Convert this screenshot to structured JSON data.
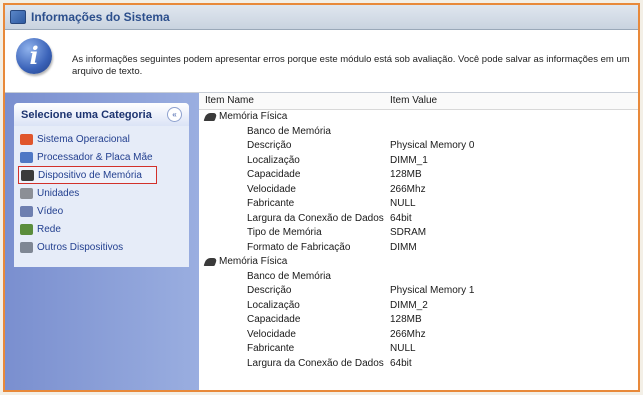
{
  "window": {
    "title": "Informações do Sistema"
  },
  "info": {
    "message": "As informações seguintes podem apresentar erros porque este módulo está sob avaliação. Você pode salvar as informações em um arquivo de texto."
  },
  "sidebar": {
    "header": "Selecione uma Categoria",
    "collapse_glyph": "«",
    "items": [
      {
        "label": "Sistema Operacional",
        "icon": "windows-flag-icon",
        "color": "#e0562c"
      },
      {
        "label": "Processador & Placa Mãe",
        "icon": "processor-icon",
        "color": "#4f78c5"
      },
      {
        "label": "Dispositivo de Memória",
        "icon": "memory-icon",
        "color": "#3b3b3b",
        "selected": true
      },
      {
        "label": "Unidades",
        "icon": "drives-icon",
        "color": "#8c8f96"
      },
      {
        "label": "Vídeo",
        "icon": "video-icon",
        "color": "#6e7fb0"
      },
      {
        "label": "Rede",
        "icon": "network-icon",
        "color": "#5b8d3c"
      },
      {
        "label": "Outros Dispositivos",
        "icon": "devices-icon",
        "color": "#7f8794"
      }
    ]
  },
  "table": {
    "col_name": "Item Name",
    "col_value": "Item Value",
    "rows": [
      {
        "group": true,
        "name": "Memória Física",
        "value": ""
      },
      {
        "name": "Banco de Memória",
        "value": ""
      },
      {
        "name": "Descrição",
        "value": "Physical Memory 0"
      },
      {
        "name": "Localização",
        "value": "DIMM_1"
      },
      {
        "name": "Capacidade",
        "value": "128MB"
      },
      {
        "name": "Velocidade",
        "value": "266Mhz"
      },
      {
        "name": "Fabricante",
        "value": "NULL"
      },
      {
        "name": "Largura da Conexão de Dados",
        "value": "64bit"
      },
      {
        "name": "Tipo de Memória",
        "value": "SDRAM"
      },
      {
        "name": "Formato de Fabricação",
        "value": "DIMM"
      },
      {
        "group": true,
        "name": "Memória Física",
        "value": ""
      },
      {
        "name": "Banco de Memória",
        "value": ""
      },
      {
        "name": "Descrição",
        "value": "Physical Memory 1"
      },
      {
        "name": "Localização",
        "value": "DIMM_2"
      },
      {
        "name": "Capacidade",
        "value": "128MB"
      },
      {
        "name": "Velocidade",
        "value": "266Mhz"
      },
      {
        "name": "Fabricante",
        "value": "NULL"
      },
      {
        "name": "Largura da Conexão de Dados",
        "value": "64bit"
      }
    ]
  }
}
